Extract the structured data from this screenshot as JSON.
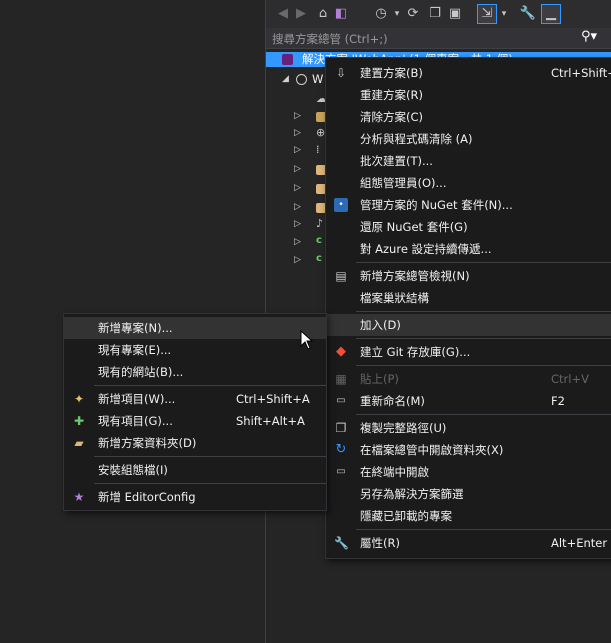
{
  "search": {
    "placeholder": "搜尋方案總管 (Ctrl+;)"
  },
  "tree": {
    "selected_label": "解決方案 'WebApp' (1 個專案，共 1 個)",
    "child_label": "W"
  },
  "context_menu": {
    "items": [
      {
        "label": "建置方案(B)",
        "shortcut": "Ctrl+Shift+B",
        "icon": "build-icon"
      },
      {
        "label": "重建方案(R)"
      },
      {
        "label": "清除方案(C)"
      },
      {
        "label": "分析與程式碼清除 (A)"
      },
      {
        "label": "批次建置(T)..."
      },
      {
        "label": "組態管理員(O)..."
      },
      {
        "label": "管理方案的 NuGet 套件(N)...",
        "icon": "nuget-icon"
      },
      {
        "label": "還原 NuGet 套件(G)"
      },
      {
        "label": "對 Azure 設定持續傳遞..."
      },
      {
        "label": "新增方案總管檢視(N)",
        "icon": "new-view-icon"
      },
      {
        "label": "檔案巢狀結構"
      },
      {
        "label": "加入(D)"
      },
      {
        "label": "建立 Git 存放庫(G)...",
        "icon": "git-icon"
      },
      {
        "label": "貼上(P)",
        "shortcut": "Ctrl+V",
        "icon": "paste-icon",
        "disabled": true
      },
      {
        "label": "重新命名(M)",
        "shortcut": "F2",
        "icon": "rename-icon"
      },
      {
        "label": "複製完整路徑(U)",
        "icon": "copy-path-icon"
      },
      {
        "label": "在檔案總管中開啟資料夾(X)",
        "icon": "open-folder-icon"
      },
      {
        "label": "在終端中開啟",
        "icon": "terminal-icon"
      },
      {
        "label": "另存為解決方案篩選"
      },
      {
        "label": "隱藏已卸載的專案"
      },
      {
        "label": "屬性(R)",
        "shortcut": "Alt+Enter",
        "icon": "wrench-icon"
      }
    ]
  },
  "submenu": {
    "items": [
      {
        "label": "新增專案(N)..."
      },
      {
        "label": "現有專案(E)..."
      },
      {
        "label": "現有的網站(B)..."
      },
      {
        "label": "新增項目(W)...",
        "shortcut": "Ctrl+Shift+A",
        "icon": "new-item-icon"
      },
      {
        "label": "現有項目(G)...",
        "shortcut": "Shift+Alt+A",
        "icon": "existing-item-icon"
      },
      {
        "label": "新增方案資料夾(D)",
        "icon": "new-folder-icon"
      },
      {
        "label": "安裝組態檔(I)"
      },
      {
        "label": "新增 EditorConfig",
        "icon": "editorconfig-icon"
      }
    ]
  },
  "colors": {
    "selection": "#3399ff",
    "menu_bg": "#1b1b1c",
    "highlight": "#333334"
  }
}
